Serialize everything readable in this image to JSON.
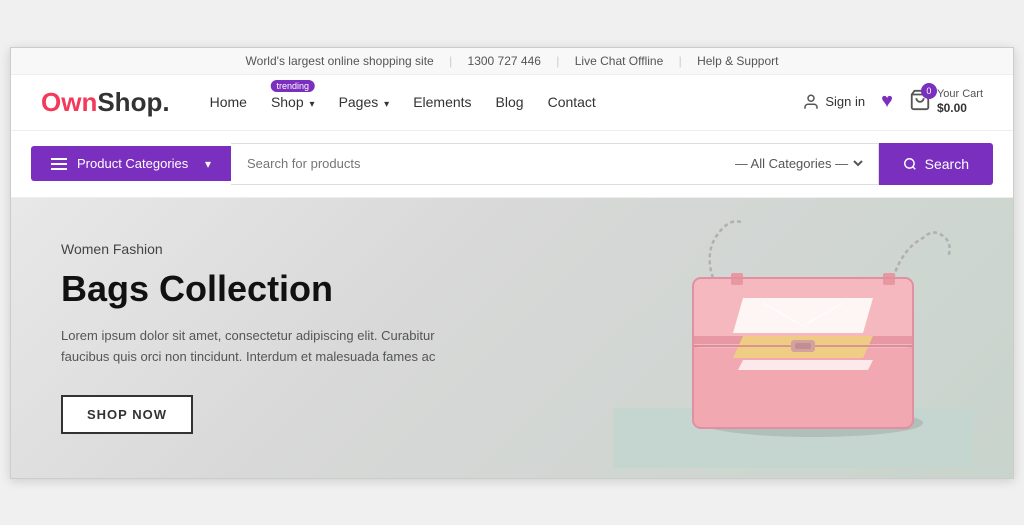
{
  "topbar": {
    "tagline": "World's largest online shopping site",
    "phone": "1300 727 446",
    "livechat": "Live Chat Offline",
    "help": "Help & Support"
  },
  "logo": {
    "own": "Own",
    "shop": "Shop",
    "dot": "."
  },
  "nav": {
    "items": [
      {
        "label": "Home",
        "has_arrow": false,
        "trending": false
      },
      {
        "label": "Shop",
        "has_arrow": true,
        "trending": true
      },
      {
        "label": "Pages",
        "has_arrow": true,
        "trending": false
      },
      {
        "label": "Elements",
        "has_arrow": false,
        "trending": false
      },
      {
        "label": "Blog",
        "has_arrow": false,
        "trending": false
      },
      {
        "label": "Contact",
        "has_arrow": false,
        "trending": false
      }
    ],
    "trending_label": "trending"
  },
  "header_actions": {
    "signin": "Sign in",
    "cart_count": "0",
    "cart_label": "Your Cart",
    "cart_amount": "$0.00"
  },
  "search": {
    "category_btn_label": "Product Categories",
    "placeholder": "Search for products",
    "all_categories": "— All Categories —",
    "search_btn": "Search"
  },
  "hero": {
    "subtitle": "Women Fashion",
    "title": "Bags Collection",
    "description": "Lorem ipsum dolor sit amet, consectetur adipiscing elit. Curabitur faucibus quis orci non tincidunt. Interdum et malesuada fames ac",
    "cta": "SHOP NOW"
  }
}
